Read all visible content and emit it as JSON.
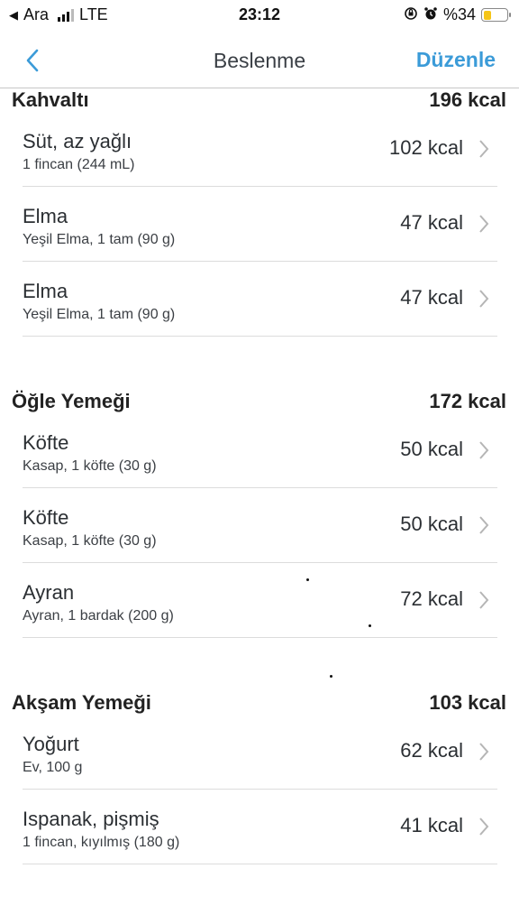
{
  "status_bar": {
    "back_app": "Ara",
    "network": "LTE",
    "time": "23:12",
    "battery_percent": "%34",
    "battery_level": 0.34,
    "battery_color": "#f5c518"
  },
  "nav": {
    "back_icon": "chevron-left-icon",
    "title": "Beslenme",
    "edit_label": "Düzenle",
    "accent_color": "#3b9bd8"
  },
  "sections": [
    {
      "title": "Kahvaltı",
      "kcal": "196 kcal",
      "items": [
        {
          "name": "Süt, az yağlı",
          "desc": "1 fincan (244 mL)",
          "kcal": "102 kcal"
        },
        {
          "name": "Elma",
          "desc": "Yeşil Elma, 1 tam (90 g)",
          "kcal": "47 kcal"
        },
        {
          "name": "Elma",
          "desc": "Yeşil Elma, 1 tam (90 g)",
          "kcal": "47 kcal"
        }
      ]
    },
    {
      "title": "Öğle Yemeği",
      "kcal": "172 kcal",
      "items": [
        {
          "name": "Köfte",
          "desc": "Kasap, 1 köfte (30 g)",
          "kcal": "50 kcal"
        },
        {
          "name": "Köfte",
          "desc": "Kasap, 1 köfte (30 g)",
          "kcal": "50 kcal"
        },
        {
          "name": "Ayran",
          "desc": "Ayran, 1 bardak (200 g)",
          "kcal": "72 kcal"
        }
      ]
    },
    {
      "title": "Akşam Yemeği",
      "kcal": "103 kcal",
      "items": [
        {
          "name": "Yoğurt",
          "desc": "Ev, 100 g",
          "kcal": "62 kcal"
        },
        {
          "name": "Ispanak, pişmiş",
          "desc": "1 fincan, kıyılmış (180 g)",
          "kcal": "41 kcal"
        }
      ]
    }
  ]
}
